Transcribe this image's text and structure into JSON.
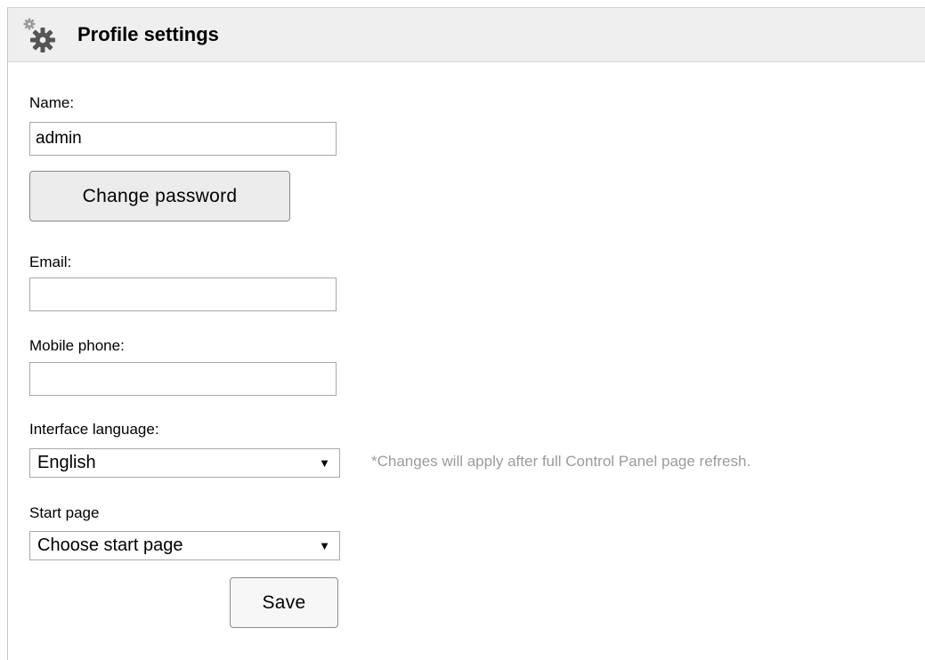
{
  "panel": {
    "title": "Profile settings",
    "icon": "gear-icon"
  },
  "form": {
    "name_label": "Name:",
    "name_value": "admin",
    "change_password_label": "Change password",
    "email_label": "Email:",
    "email_value": "",
    "mobile_label": "Mobile phone:",
    "mobile_value": "",
    "language_label": "Interface language:",
    "language_value": "English",
    "language_note": "*Changes will apply after full Control Panel page refresh.",
    "start_page_label": "Start page",
    "start_page_value": "Choose start page",
    "save_label": "Save"
  },
  "colors": {
    "header_bg": "#efefef",
    "note_text": "#9b9b9b",
    "field_border": "#a9a9a9"
  }
}
